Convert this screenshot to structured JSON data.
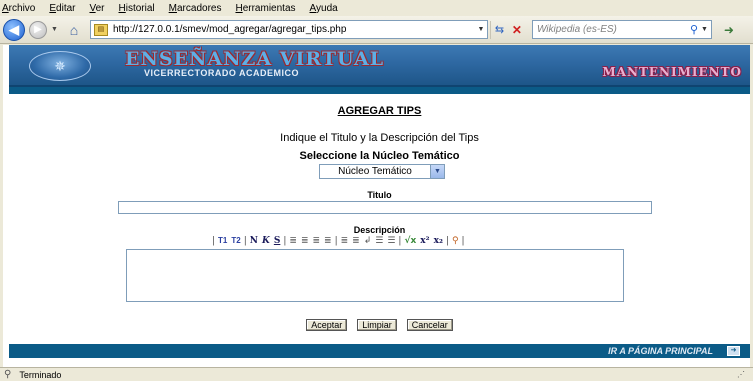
{
  "browser": {
    "menu": [
      "Archivo",
      "Editar",
      "Ver",
      "Historial",
      "Marcadores",
      "Herramientas",
      "Ayuda"
    ],
    "url": "http://127.0.0.1/smev/mod_agregar/agregar_tips.php",
    "search_placeholder": "Wikipedia (es-ES)",
    "status_text": "Terminado"
  },
  "banner": {
    "title": "ENSEÑANZA VIRTUAL",
    "subtitle": "VICERRECTORADO ACADEMICO",
    "section": "MANTENIMIENTO"
  },
  "form": {
    "heading": "AGREGAR TIPS",
    "instruction": "Indique el Titulo y la Descripción del Tips",
    "nucleo_label": "Seleccione la Núcleo Temático",
    "nucleo_value": "Núcleo Temático",
    "titulo_label": "Titulo",
    "titulo_value": "",
    "descripcion_label": "Descripción",
    "descripcion_value": "",
    "toolbar": {
      "t1": "T1",
      "t2": "T2",
      "n": "N",
      "k": "K",
      "s": "S",
      "superscript": "x²",
      "subscript": "x₂"
    },
    "buttons": {
      "accept": "Aceptar",
      "clear": "Limpiar",
      "cancel": "Cancelar"
    }
  },
  "footer": {
    "link": "IR A PÁGINA PRINCIPAL"
  }
}
